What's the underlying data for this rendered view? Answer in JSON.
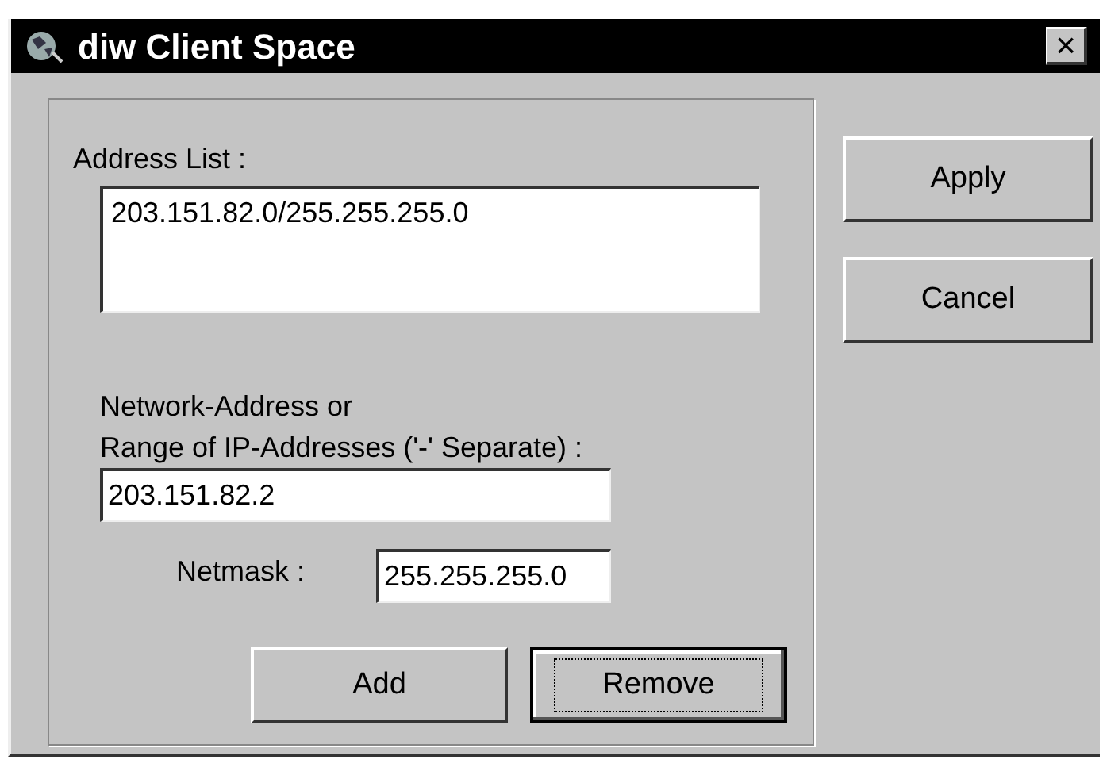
{
  "window": {
    "title": "diw Client Space",
    "close_label": "×"
  },
  "address_list": {
    "label": "Address List :",
    "items": [
      "203.151.82.0/255.255.255.0"
    ]
  },
  "network_field": {
    "label_lines": [
      "Network-Address or",
      "Range of IP-Addresses ('-' Separate) :"
    ],
    "value": "203.151.82.2"
  },
  "netmask_field": {
    "label": "Netmask :",
    "value": "255.255.255.0"
  },
  "bottom_buttons": [
    {
      "label": "Add",
      "focused": false
    },
    {
      "label": "Remove",
      "focused": true
    }
  ],
  "side_buttons": [
    {
      "label": "Apply",
      "focused": false
    },
    {
      "label": "Cancel",
      "focused": false
    }
  ]
}
